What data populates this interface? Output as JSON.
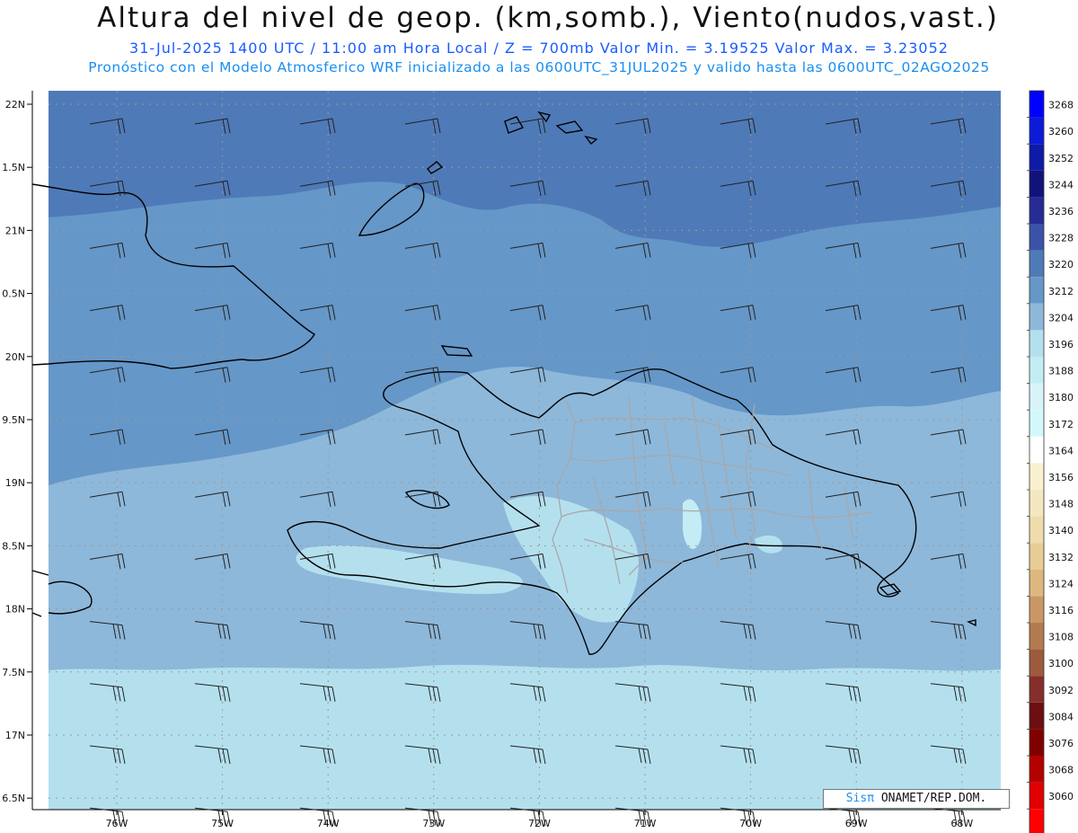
{
  "header": {
    "title": "Altura del nivel de geop. (km,somb.), Viento(nudos,vast.)",
    "subtitle": "31-Jul-2025  1400 UTC / 11:00 am Hora Local / Z = 700mb   Valor Min. = 3.19525  Valor Max. = 3.23052",
    "info": "Pronóstico con el Modelo Atmosferico WRF inicializado a las 0600UTC_31JUL2025 y valido hasta las  0600UTC_02AGO2025"
  },
  "axes": {
    "lat_labels": [
      "22N",
      "1.5N",
      "21N",
      "0.5N",
      "20N",
      "9.5N",
      "19N",
      "8.5N",
      "18N",
      "7.5N",
      "17N",
      "6.5N"
    ],
    "lon_labels": [
      "76W",
      "75W",
      "74W",
      "73W",
      "72W",
      "71W",
      "70W",
      "69W",
      "68W"
    ]
  },
  "colorbar": {
    "labels": [
      "3268",
      "3260",
      "3252",
      "3244",
      "3236",
      "3228",
      "3220",
      "3212",
      "3204",
      "3196",
      "3188",
      "3180",
      "3172",
      "3164",
      "3156",
      "3148",
      "3140",
      "3132",
      "3124",
      "3116",
      "3108",
      "3100",
      "3092",
      "3084",
      "3076",
      "3068",
      "3060"
    ],
    "colors": [
      "#0000ff",
      "#0b1bd9",
      "#0f1aa8",
      "#12137a",
      "#262c94",
      "#3a53a8",
      "#4f7ab8",
      "#6597c8",
      "#8db8da",
      "#b4e0ee",
      "#c4ecf4",
      "#d8f4f8",
      "#d2f8fb",
      "#ffffff",
      "#f9f1cf",
      "#f4e8c0",
      "#efdcaa",
      "#e8cc96",
      "#dcb87e",
      "#c99766",
      "#b37a4f",
      "#9e5a3c",
      "#862f2a",
      "#6d0e12",
      "#800000",
      "#b50000",
      "#e00000",
      "#ff0000"
    ]
  },
  "fill_colors": {
    "land_outline": "#000000",
    "province_lines": "#a8a8a8",
    "wind_barb": "#222222"
  },
  "credit": {
    "brand": "Sisπ",
    "text": " ONAMET/REP.DOM."
  }
}
